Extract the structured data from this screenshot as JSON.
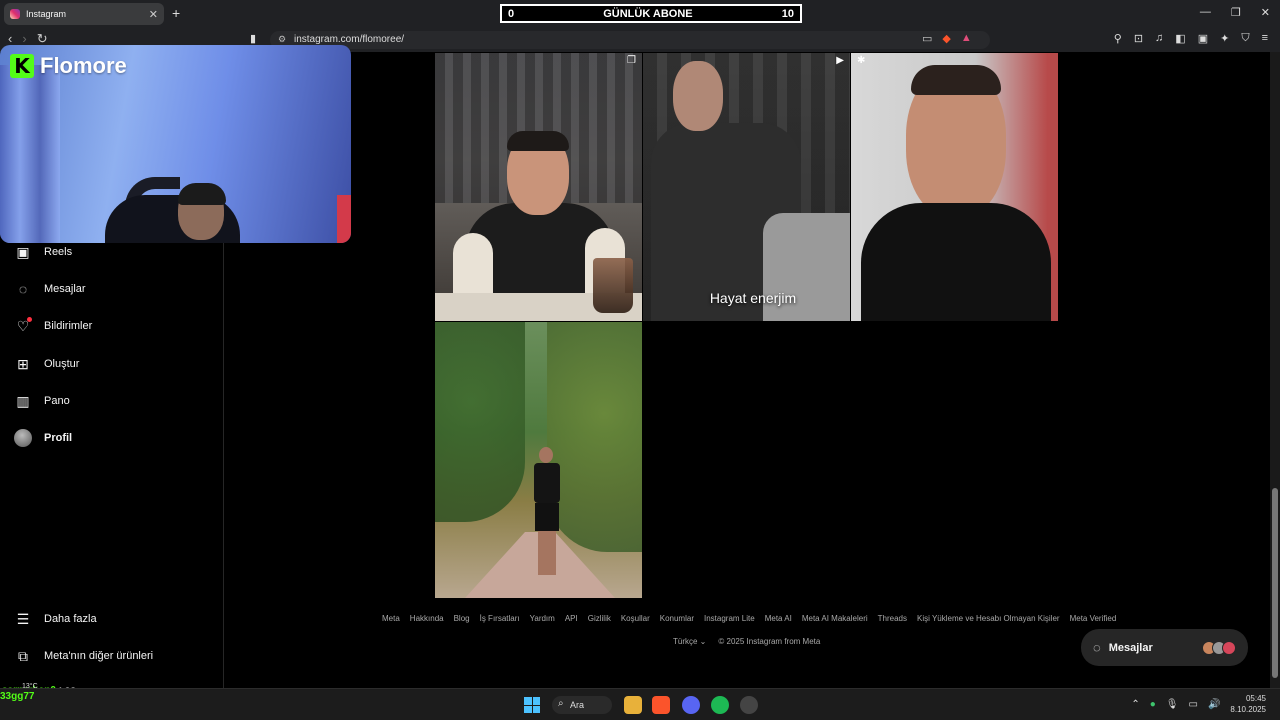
{
  "browser": {
    "tab_title": "Instagram",
    "url": "instagram.com/flomoree/"
  },
  "overlay_counter": {
    "left": "0",
    "label": "GÜNLÜK ABONE",
    "right": "10"
  },
  "stream_logo": "Flomore",
  "sidebar": {
    "items": [
      {
        "label": "Reels",
        "icon": "reels-icon"
      },
      {
        "label": "Mesajlar",
        "icon": "messenger-icon"
      },
      {
        "label": "Bildirimler",
        "icon": "heart-icon"
      },
      {
        "label": "Oluştur",
        "icon": "plus-square-icon"
      },
      {
        "label": "Pano",
        "icon": "chart-icon"
      },
      {
        "label": "Profil",
        "icon": "avatar"
      }
    ],
    "more_label": "Daha fazla",
    "meta_label": "Meta'nın diğer ürünleri"
  },
  "posts": [
    {
      "caption": ""
    },
    {
      "caption": "Hayat enerjim"
    },
    {
      "caption": ""
    },
    {
      "caption": ""
    }
  ],
  "footer": {
    "links": [
      "Meta",
      "Hakkında",
      "Blog",
      "İş Fırsatları",
      "Yardım",
      "API",
      "Gizlilik",
      "Koşullar",
      "Konumlar",
      "Instagram Lite",
      "Meta AI",
      "Meta AI Makaleleri",
      "Threads",
      "Kişi Yükleme ve Hesabı Olmayan Kişiler",
      "Meta Verified"
    ],
    "language": "Türkçe",
    "copyright": "© 2025 Instagram from Meta"
  },
  "messages_pill": {
    "label": "Mesajlar"
  },
  "chat": {
    "user": "sarparben0",
    "message": ": as",
    "second_line": "33gg77",
    "weather": "13°C"
  },
  "taskbar": {
    "search_label": "Ara",
    "time": "05:45",
    "date": "8.10.2025"
  },
  "colors": {
    "kick_green": "#53fc18",
    "background": "#000000"
  }
}
